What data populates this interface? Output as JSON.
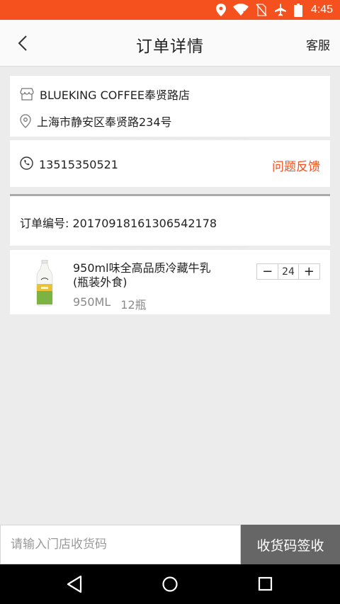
{
  "status_bar": {
    "time": "4:45",
    "icons": [
      "location-icon",
      "wifi-icon",
      "no-sim-icon",
      "airplane-icon",
      "battery-icon"
    ]
  },
  "header": {
    "back_icon": "chevron-left-icon",
    "title": "订单详情",
    "service_label": "客服"
  },
  "store": {
    "name": "BLUEKING COFFEE奉贤路店",
    "address": "上海市静安区奉贤路234号"
  },
  "contact": {
    "phone": "13515350521",
    "feedback_label": "问题反馈"
  },
  "order": {
    "number_label": "订单编号:",
    "number": "20170918161306542178"
  },
  "product": {
    "name": "950ml味全高品质冷藏牛乳(瓶装外食)",
    "volume": "950ML",
    "count": "12瓶",
    "quantity": "24",
    "minus": "−",
    "plus": "+"
  },
  "bottom": {
    "input_placeholder": "请输入门店收货码",
    "sign_label": "收货码签收"
  },
  "colors": {
    "accent": "#f4511e",
    "button_gray": "#666666",
    "background": "#ececec"
  }
}
